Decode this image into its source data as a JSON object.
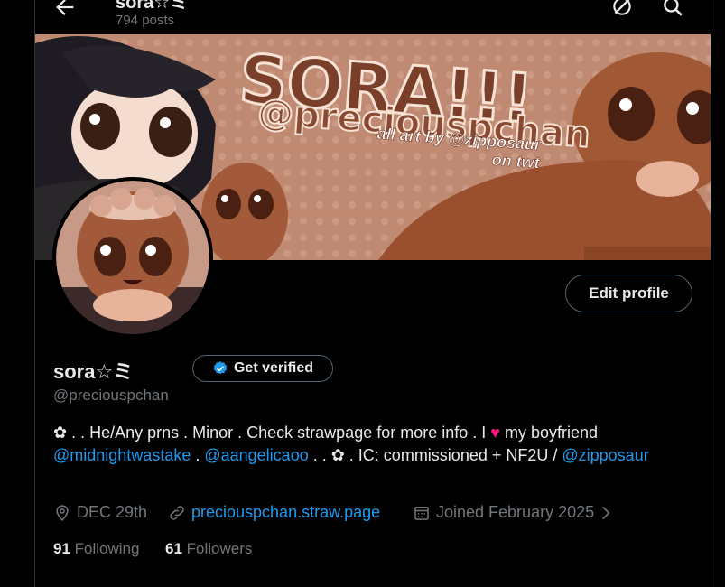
{
  "header": {
    "name": "sora☆ミ",
    "post_count": "794 posts"
  },
  "banner": {
    "title": "SORA!!!",
    "handle": "@preciouspchan",
    "credit_line1": "all art by @zipposaur",
    "credit_line2": "on twt"
  },
  "profile": {
    "edit_label": "Edit profile",
    "display_name": "sora☆ミ",
    "verify_label": "Get verified",
    "handle": "@preciouspchan",
    "bio": {
      "part1": "✿ .  .  He/Any prns  .  Minor  .  Check strawpage for more info  .  I ",
      "heart": "♥",
      "part2": " my boyfriend ",
      "mention1": "@midnightwastake",
      "sep": "  .  ",
      "mention2": "@aangelicaoo",
      "part3": "  .  . ✿  .  IC: commissioned + NF2U / ",
      "mention3": "@zipposaur"
    },
    "location": "DEC 29th",
    "website": "preciouspchan.straw.page",
    "joined": "Joined February 2025",
    "following_count": "91",
    "following_label": "Following",
    "followers_count": "61",
    "followers_label": "Followers"
  },
  "colors": {
    "background": "#000000",
    "text": "#e7e9ea",
    "muted": "#71767b",
    "link": "#1d9bf0",
    "verified": "#1d9bf0",
    "heart": "#f91880"
  },
  "icons": [
    "back-arrow-icon",
    "grok-icon",
    "search-icon",
    "verified-badge-icon",
    "location-icon",
    "link-icon",
    "calendar-icon",
    "chevron-right-icon"
  ]
}
